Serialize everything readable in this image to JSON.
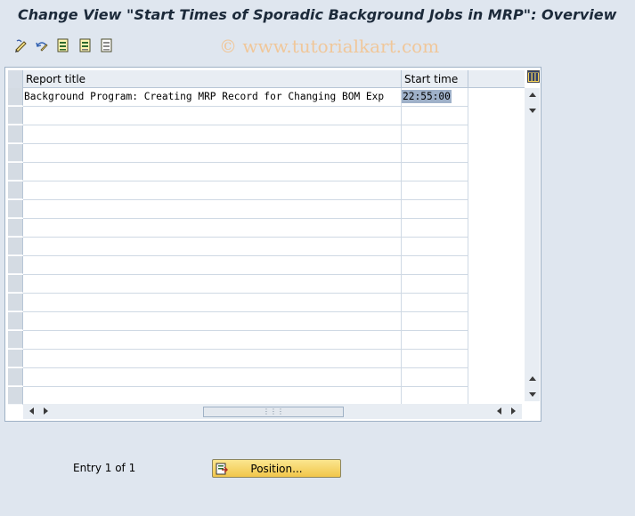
{
  "window": {
    "title": "Change View \"Start Times of Sporadic Background Jobs in MRP\": Overview"
  },
  "toolbar": {
    "icons": [
      "edit-pencil-icon",
      "undo-change-icon",
      "select-all-icon",
      "select-block-icon",
      "deselect-all-icon"
    ]
  },
  "watermark": "© www.tutorialkart.com",
  "table": {
    "columns": [
      "Report title",
      "Start time"
    ],
    "rows": [
      {
        "report_title": "Background Program: Creating MRP Record for Changing BOM Exp",
        "start_time": "22:55:00"
      }
    ],
    "empty_rows": 16
  },
  "footer": {
    "entry_text": "Entry 1 of 1",
    "position_label": "Position..."
  },
  "colors": {
    "background": "#dfe6ef",
    "button": "#f1c64a",
    "selection": "#9fb1c9"
  }
}
